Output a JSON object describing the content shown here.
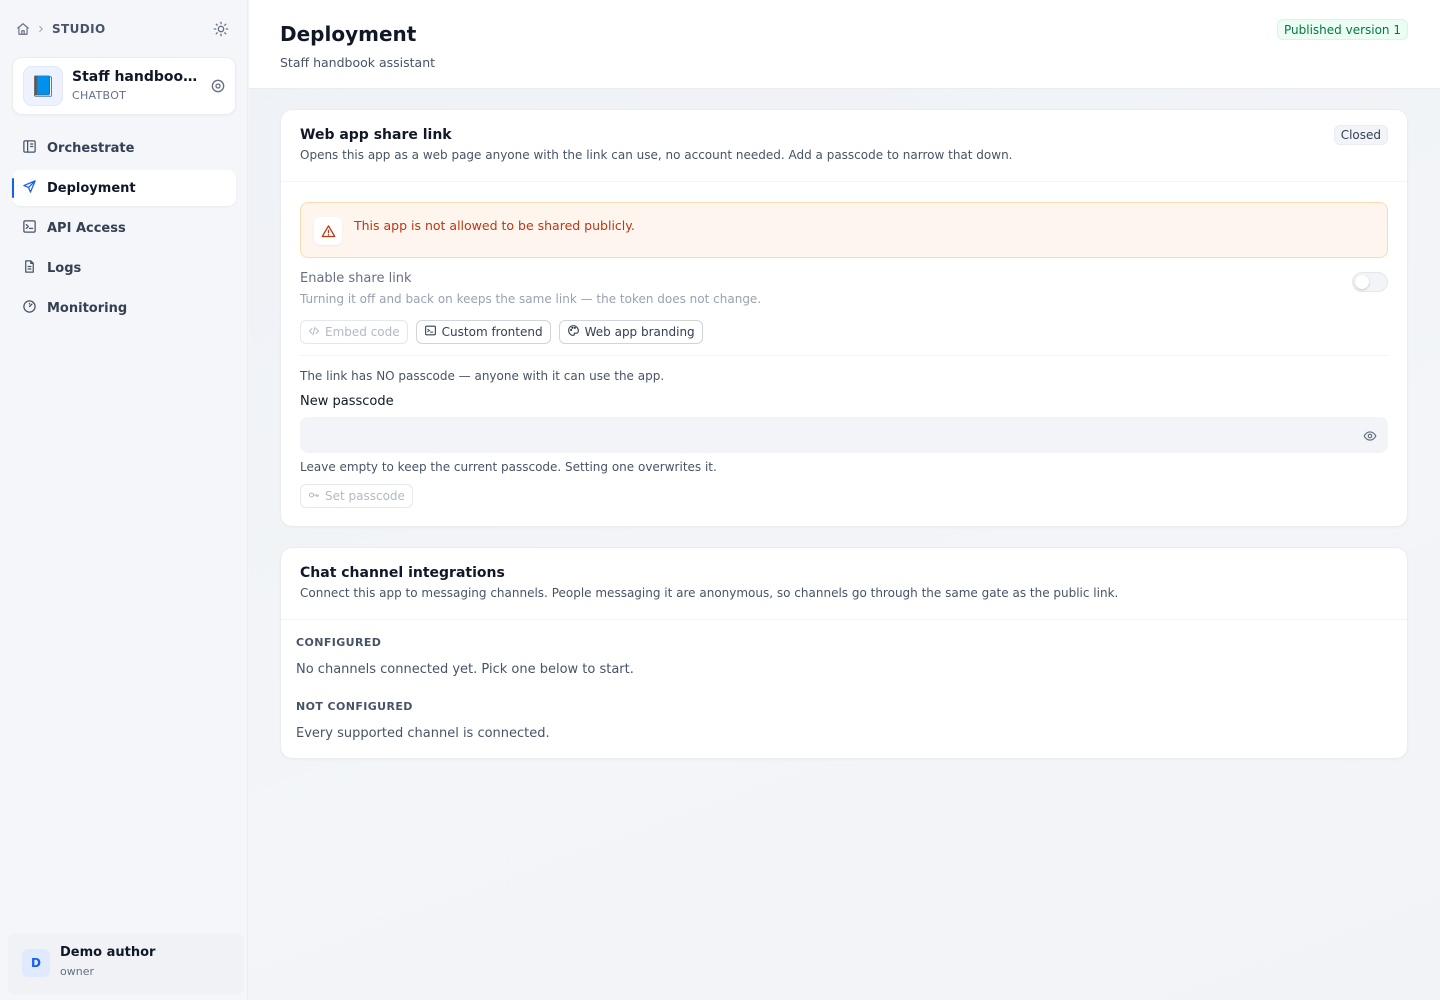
{
  "breadcrumb": {
    "label": "STUDIO"
  },
  "app": {
    "name": "Staff handbook assistant",
    "type": "CHATBOT",
    "emoji": "📘"
  },
  "nav": {
    "items": [
      {
        "label": "Orchestrate",
        "icon": "layout-icon"
      },
      {
        "label": "Deployment",
        "icon": "send-icon",
        "active": true
      },
      {
        "label": "API Access",
        "icon": "terminal-icon"
      },
      {
        "label": "Logs",
        "icon": "file-icon"
      },
      {
        "label": "Monitoring",
        "icon": "gauge-icon"
      }
    ]
  },
  "user": {
    "initial": "D",
    "name": "Demo author",
    "role": "owner"
  },
  "header": {
    "title": "Deployment",
    "subtitle": "Staff handbook assistant",
    "published_badge": "Published version 1"
  },
  "share": {
    "title": "Web app share link",
    "description": "Opens this app as a web page anyone with the link can use, no account needed. Add a passcode to narrow that down.",
    "status_badge": "Closed",
    "warning": "This app is not allowed to be shared publicly.",
    "enable_label": "Enable share link",
    "enable_help": "Turning it off and back on keeps the same link — the token does not change.",
    "enabled": false,
    "buttons": {
      "embed": "Embed code",
      "custom_frontend": "Custom frontend",
      "branding": "Web app branding"
    },
    "passcode_status": "The link has NO passcode — anyone with it can use the app.",
    "passcode_label": "New passcode",
    "passcode_value": "",
    "passcode_placeholder": "",
    "passcode_help": "Leave empty to keep the current passcode. Setting one overwrites it.",
    "set_passcode": "Set passcode"
  },
  "channels": {
    "title": "Chat channel integrations",
    "description": "Connect this app to messaging channels. People messaging it are anonymous, so channels go through the same gate as the public link.",
    "configured_label": "CONFIGURED",
    "configured_empty": "No channels connected yet. Pick one below to start.",
    "not_configured_label": "NOT CONFIGURED",
    "not_configured_empty": "Every supported channel is connected."
  },
  "colors": {
    "accent": "#155eef",
    "warning_bg": "#fef6ee",
    "warning_text": "#b93815",
    "success": "#067647"
  }
}
